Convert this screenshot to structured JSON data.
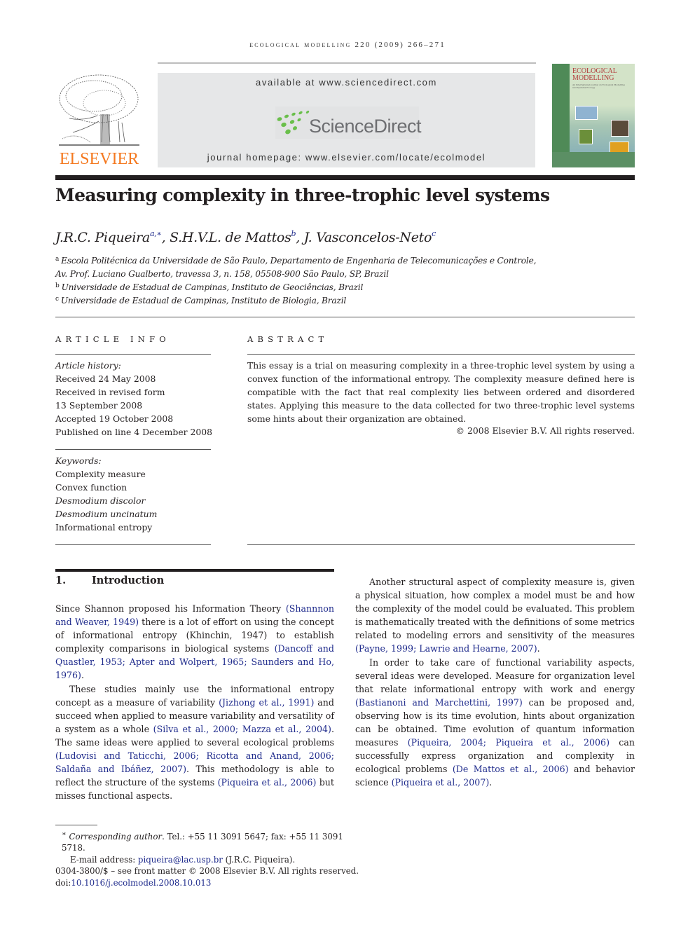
{
  "running_head": "ecological modelling 220 (2009) 266–271",
  "header": {
    "publisher_logo_text": "ELSEVIER",
    "available_text": "available at www.sciencedirect.com",
    "sciencedirect_text": "ScienceDirect",
    "homepage_text": "journal homepage: www.elsevier.com/locate/ecolmodel",
    "cover_title_line1": "ECOLOGICAL",
    "cover_title_line2": "MODELLING",
    "cover_subtitle": "An International Journal on Ecological Modelling and Systems Ecology"
  },
  "colors": {
    "elsevier_orange": "#f47920",
    "citation_blue": "#1f2b8c",
    "sciencedirect_green": "#6abf4b",
    "sciencedirect_gray": "#6d6e71",
    "banner_gray": "#e6e7e8"
  },
  "article": {
    "title": "Measuring complexity in three-trophic level systems",
    "authors": [
      {
        "name": "J.R.C. Piqueira",
        "sup": "a,∗"
      },
      {
        "name": "S.H.V.L. de Mattos",
        "sup": "b"
      },
      {
        "name": "J. Vasconcelos-Neto",
        "sup": "c"
      }
    ],
    "author_sep": ", ",
    "affiliations": [
      {
        "mark": "a",
        "text": "Escola Politécnica da Universidade de São Paulo, Departamento de Engenharia de Telecomunicações e Controle,"
      },
      {
        "mark": "",
        "text": "Av. Prof. Luciano Gualberto, travessa 3, n. 158, 05508-900 São Paulo, SP, Brazil"
      },
      {
        "mark": "b",
        "text": "Universidade de Estadual de Campinas, Instituto de Geociências, Brazil"
      },
      {
        "mark": "c",
        "text": "Universidade de Estadual de Campinas, Instituto de Biologia, Brazil"
      }
    ]
  },
  "article_info": {
    "label": "ARTICLE INFO",
    "history_label": "Article history:",
    "history": [
      "Received 24 May 2008",
      "Received in revised form",
      "13 September 2008",
      "Accepted 19 October 2008",
      "Published on line 4 December 2008"
    ],
    "keywords_label": "Keywords:",
    "keywords": [
      {
        "text": "Complexity measure",
        "italic": false
      },
      {
        "text": "Convex function",
        "italic": false
      },
      {
        "text": "Desmodium discolor",
        "italic": true
      },
      {
        "text": "Desmodium uncinatum",
        "italic": true
      },
      {
        "text": "Informational entropy",
        "italic": false
      }
    ]
  },
  "abstract": {
    "label": "ABSTRACT",
    "text": "This essay is a trial on measuring complexity in a three-trophic level system by using a convex function of the informational entropy. The complexity measure defined here is compatible with the fact that real complexity lies between ordered and disordered states. Applying this measure to the data collected for two three-trophic level systems some hints about their organization are obtained.",
    "copyright": "© 2008 Elsevier B.V. All rights reserved."
  },
  "introduction": {
    "number": "1.",
    "heading": "Introduction",
    "col1": {
      "p1": [
        {
          "t": "Since Shannon proposed his Information Theory "
        },
        {
          "t": "(Shannnon and Weaver, 1949)",
          "cite": true
        },
        {
          "t": " there is a lot of effort on using the concept of informational entropy (Khinchin, 1947) to establish complexity comparisons in biological systems "
        },
        {
          "t": "(Dancoff and Quastler, 1953; Apter and Wolpert, 1965; Saunders and Ho, 1976)",
          "cite": true
        },
        {
          "t": "."
        }
      ],
      "p2": [
        {
          "t": "These studies mainly use the informational entropy concept as a measure of variability "
        },
        {
          "t": "(Jizhong et al., 1991)",
          "cite": true
        },
        {
          "t": " and succeed when applied to measure variability and versatility of a system as a whole "
        },
        {
          "t": "(Silva et al., 2000; Mazza et al., 2004)",
          "cite": true
        },
        {
          "t": ". The same ideas were applied to several ecological problems "
        },
        {
          "t": "(Ludovisi and Taticchi, 2006; Ricotta and Anand, 2006; Saldaña and Ibáñez, 2007)",
          "cite": true
        },
        {
          "t": ". This methodology is able to reflect the structure of the systems "
        },
        {
          "t": "(Piqueira et al., 2006)",
          "cite": true
        },
        {
          "t": " but misses functional aspects."
        }
      ]
    },
    "col2": {
      "p1": [
        {
          "t": "Another structural aspect of complexity measure is, given a physical situation, how complex a model must be and how the complexity of the model could be evaluated. This problem is mathematically treated with the definitions of some metrics related to modeling errors and sensitivity of the measures "
        },
        {
          "t": "(Payne, 1999; Lawrie and Hearne, 2007)",
          "cite": true
        },
        {
          "t": "."
        }
      ],
      "p2": [
        {
          "t": "In order to take care of functional variability aspects, several ideas were developed. Measure for organization level that relate informational entropy with work and energy "
        },
        {
          "t": "(Bastianoni and Marchettini, 1997)",
          "cite": true
        },
        {
          "t": " can be proposed and, observing how is its time evolution, hints about organization can be obtained. Time evolution of quantum information measures "
        },
        {
          "t": "(Piqueira, 2004; Piqueira et al., 2006)",
          "cite": true
        },
        {
          "t": " can successfully express organization and complexity in ecological problems "
        },
        {
          "t": "(De Mattos et al., 2006)",
          "cite": true
        },
        {
          "t": " and behavior science "
        },
        {
          "t": "(Piqueira et al., 2007)",
          "cite": true
        },
        {
          "t": "."
        }
      ]
    }
  },
  "footnotes": {
    "star": "∗",
    "corresponding_label": "Corresponding author",
    "corresponding_rest": ". Tel.: +55 11 3091 5647; fax: +55 11 3091 5718.",
    "email_label": "E-mail address: ",
    "email": "piqueira@lac.usp.br",
    "email_after": " (J.R.C. Piqueira).",
    "front_matter": "0304-3800/$ – see front matter © 2008 Elsevier B.V. All rights reserved.",
    "doi_label": "doi:",
    "doi": "10.1016/j.ecolmodel.2008.10.013"
  }
}
